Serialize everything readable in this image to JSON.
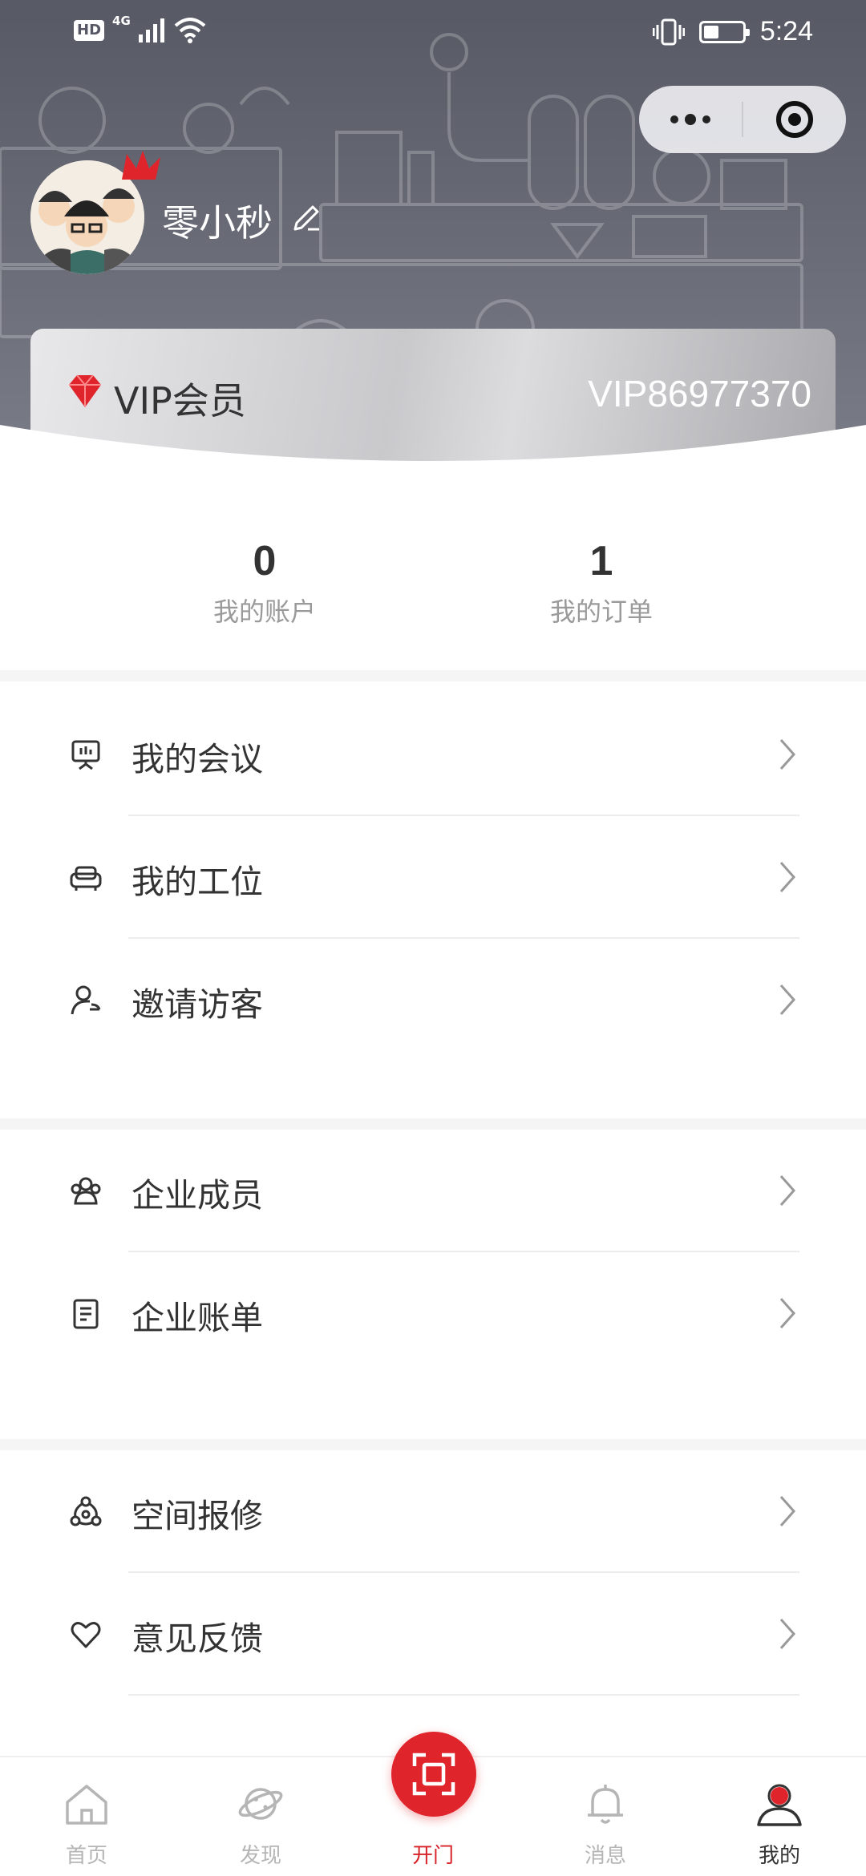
{
  "status_bar": {
    "hd": "HD",
    "network": "4G",
    "time": "5:24",
    "battery_level": 0.4
  },
  "capsule": {
    "more_icon": "ellipsis-icon",
    "close_icon": "target-circle-icon"
  },
  "profile": {
    "username": "零小秒",
    "avatar_icon": "avatar-photo",
    "edit_icon": "pencil-icon"
  },
  "vip": {
    "title": "VIP会员",
    "number": "VIP86977370",
    "gem_color": "#e0242c"
  },
  "stats": [
    {
      "value": "0",
      "label": "我的账户"
    },
    {
      "value": "1",
      "label": "我的订单"
    }
  ],
  "menu_groups": [
    {
      "items": [
        {
          "label": "我的会议",
          "icon": "presentation-board-icon"
        },
        {
          "label": "我的工位",
          "icon": "sofa-seat-icon"
        },
        {
          "label": "邀请访客",
          "icon": "user-add-icon"
        }
      ]
    },
    {
      "items": [
        {
          "label": "企业成员",
          "icon": "group-icon"
        },
        {
          "label": "企业账单",
          "icon": "bill-icon"
        }
      ]
    },
    {
      "items": [
        {
          "label": "空间报修",
          "icon": "repair-network-icon"
        },
        {
          "label": "意见反馈",
          "icon": "heart-icon"
        }
      ]
    }
  ],
  "bottom_nav": [
    {
      "label": "首页",
      "icon": "home-icon",
      "state": "inactive"
    },
    {
      "label": "发现",
      "icon": "planet-icon",
      "state": "inactive"
    },
    {
      "label": "开门",
      "icon": "scan-frame-icon",
      "state": "primary"
    },
    {
      "label": "消息",
      "icon": "bell-icon",
      "state": "inactive"
    },
    {
      "label": "我的",
      "icon": "user-icon",
      "state": "active"
    }
  ],
  "colors": {
    "accent": "#e0242c",
    "header_bg": "#5d5f6a",
    "text_primary": "#333333",
    "text_secondary": "#9a9a9a"
  }
}
